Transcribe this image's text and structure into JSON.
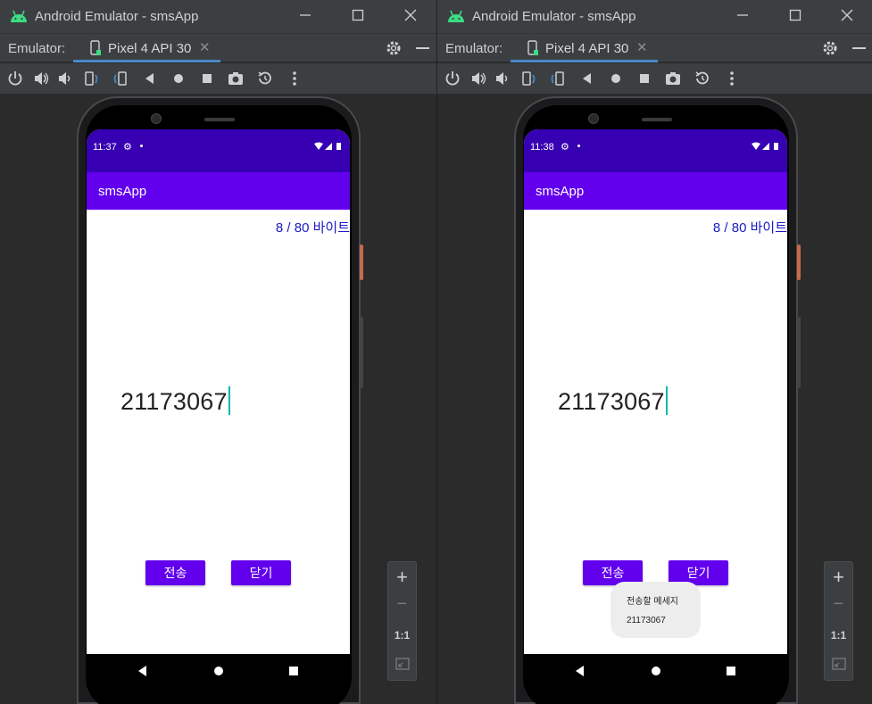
{
  "windows": [
    {
      "title": "Android Emulator - smsApp",
      "emulator_label": "Emulator:",
      "device_tab": "Pixel 4 API 30",
      "status_time": "11:37",
      "app_title": "smsApp",
      "byte_counter": "8 / 80 바이트",
      "message_text": "21173067",
      "send_button": "전송",
      "close_button": "닫기",
      "toast": null
    },
    {
      "title": "Android Emulator - smsApp",
      "emulator_label": "Emulator:",
      "device_tab": "Pixel 4 API 30",
      "status_time": "11:38",
      "app_title": "smsApp",
      "byte_counter": "8 / 80 바이트",
      "message_text": "21173067",
      "send_button": "전송",
      "close_button": "닫기",
      "toast": {
        "line1": "전송할 메세지",
        "line2": "21173067"
      }
    }
  ],
  "zoom_controls": {
    "zoom_in": "+",
    "zoom_out": "−",
    "one_to_one": "1:1"
  },
  "icons": {
    "titlebar": [
      "android-logo-icon",
      "minimize-icon",
      "maximize-icon",
      "close-icon"
    ],
    "toolbar": [
      "power-icon",
      "volume-up-icon",
      "volume-down-icon",
      "rotate-left-icon",
      "rotate-right-icon",
      "back-icon",
      "home-icon",
      "overview-icon",
      "screenshot-icon",
      "snapshot-icon",
      "more-icon"
    ]
  },
  "colors": {
    "status_bar": "#3700b3",
    "app_bar": "#6200ee",
    "button": "#6200ee",
    "byte_text": "#1a1ac8",
    "tab_underline": "#4a88c7"
  }
}
